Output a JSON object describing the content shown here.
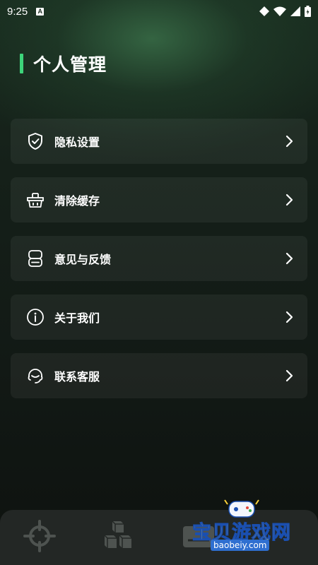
{
  "status_bar": {
    "time": "9:25",
    "notification_icon": "A"
  },
  "page": {
    "title": "个人管理"
  },
  "menu": {
    "items": [
      {
        "label": "隐私设置",
        "icon": "shield-check-icon"
      },
      {
        "label": "清除缓存",
        "icon": "basket-icon"
      },
      {
        "label": "意见与反馈",
        "icon": "feedback-icon"
      },
      {
        "label": "关于我们",
        "icon": "info-icon"
      },
      {
        "label": "联系客服",
        "icon": "headset-icon"
      }
    ]
  },
  "tab_bar": {
    "tabs": [
      "crosshair-icon",
      "cubes-icon",
      "profile-card-icon"
    ]
  },
  "watermark": {
    "title": "宝贝游戏网",
    "url": "baobeiy.com"
  },
  "colors": {
    "accent": "#3dd47a",
    "background": "#121915",
    "card": "#1d241f"
  }
}
